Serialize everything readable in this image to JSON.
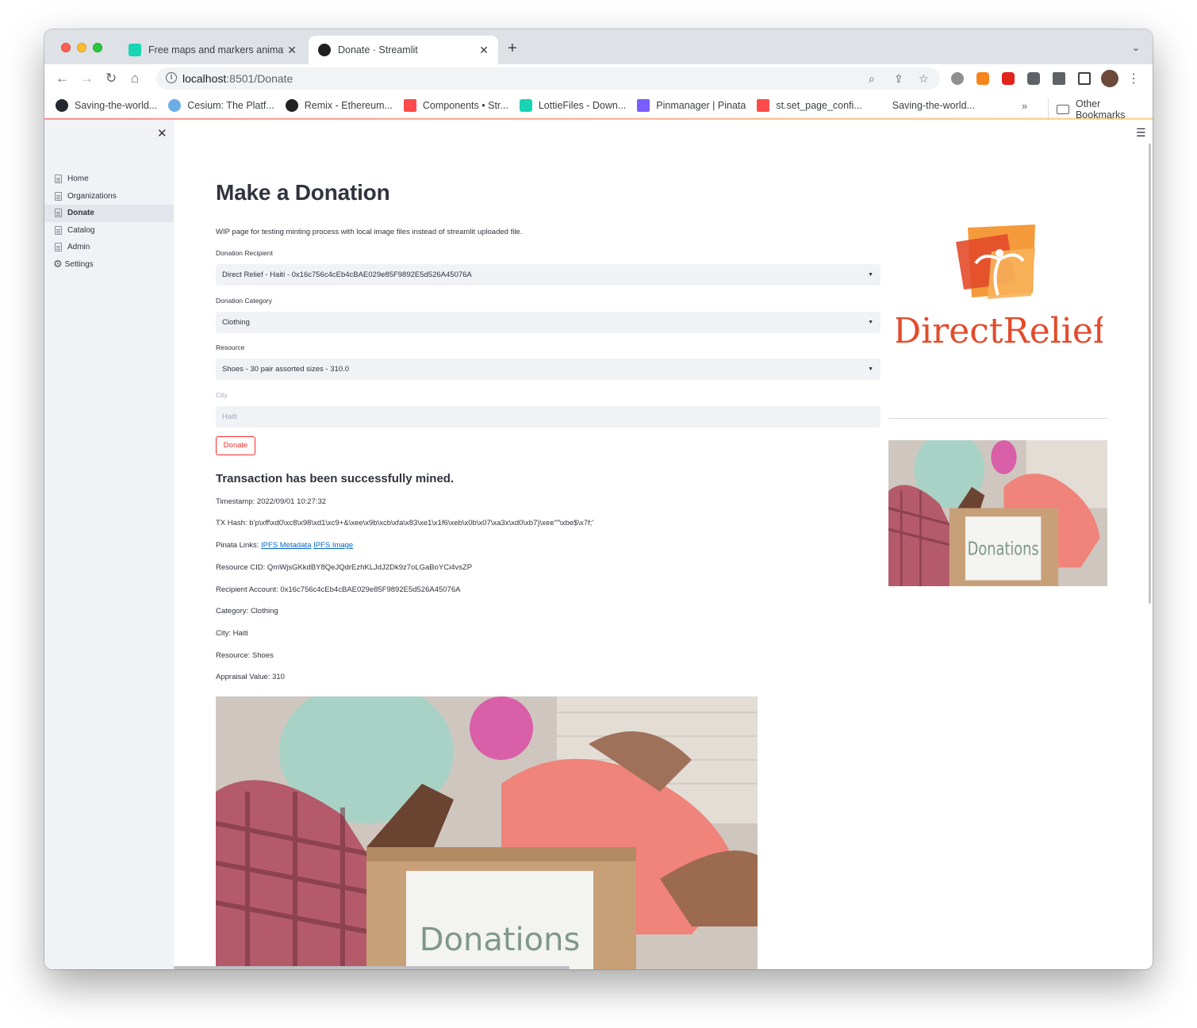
{
  "browser": {
    "tabs": [
      {
        "title": "Free maps and markers animat",
        "close": "✕",
        "active": false
      },
      {
        "title": "Donate · Streamlit",
        "close": "✕",
        "active": true
      }
    ],
    "new_tab": "+",
    "url_host": "localhost",
    "url_path": ":8501/Donate",
    "bookmarks": [
      {
        "label": "Saving-the-world...",
        "icon": "github-icon",
        "color": "#24292f"
      },
      {
        "label": "Cesium: The Platf...",
        "icon": "cesium-icon",
        "color": "#6cade5"
      },
      {
        "label": "Remix - Ethereum...",
        "icon": "remix-icon",
        "color": "#222222"
      },
      {
        "label": "Components • Str...",
        "icon": "streamlit-icon",
        "color": "#ff4b4b"
      },
      {
        "label": "LottieFiles - Down...",
        "icon": "lottie-icon",
        "color": "#17d4b4"
      },
      {
        "label": "Pinmanager | Pinata",
        "icon": "pinata-icon",
        "color": "#7a5cff"
      },
      {
        "label": "st.set_page_confi...",
        "icon": "streamlit-icon",
        "color": "#ff4b4b"
      },
      {
        "label": "Saving-the-world...",
        "icon": "blank-icon",
        "color": "#ffffff"
      }
    ],
    "more_bookmarks": "»",
    "other_bookmarks": "Other Bookmarks"
  },
  "sidebar": {
    "close": "✕",
    "items": [
      {
        "label": "Home",
        "icon": "page-icon",
        "active": false
      },
      {
        "label": "Organizations",
        "icon": "page-icon",
        "active": false
      },
      {
        "label": "Donate",
        "icon": "page-icon",
        "active": true
      },
      {
        "label": "Catalog",
        "icon": "page-icon",
        "active": false
      },
      {
        "label": "Admin",
        "icon": "page-icon",
        "active": false
      },
      {
        "label": "Settings",
        "icon": "gear-icon",
        "active": false
      }
    ]
  },
  "main": {
    "title": "Make a Donation",
    "description": "WIP page for testing minting process with local image files instead of streamlit uploaded file.",
    "recipient_label": "Donation Recipient",
    "recipient_value": "Direct Relief - Haiti - 0x16c756c4cEb4cBAE029e85F9892E5d526A45076A",
    "category_label": "Donation Category",
    "category_value": "Clothing",
    "resource_label": "Resource",
    "resource_value": "Shoes - 30 pair assorted sizes - 310.0",
    "city_label": "City",
    "city_value": "Haiti",
    "donate_button": "Donate",
    "success_heading": "Transaction has been successfully mined.",
    "timestamp": "Timestamp: 2022/09/01 10:27:32",
    "tx_hash": "TX Hash: b'p\\xff\\xd0\\xc8\\x98\\xd1\\xc9+&\\xee\\x9b\\xcb\\xfa\\x83\\xe1\\x1f6\\xeb\\x0b\\x07\\xa3x\\xd0\\xb7)\\xee\"\"\\xbe$\\x7f;'",
    "pinata_prefix": "Pinata Links: ",
    "ipfs_metadata": "IPFS Metadata",
    "ipfs_image": "IPFS Image",
    "resource_cid": "Resource CID: QmWjsGKkdBY8QeJQdrEzhKLJdJ2Dk9z7oLGaBoYCi4vsZP",
    "recipient_account": "Recipient Account: 0x16c756c4cEb4cBAE029e85F9892E5d526A45076A",
    "category": "Category: Clothing",
    "city": "City: Haiti",
    "resource": "Resource: Shoes",
    "appraisal": "Appraisal Value: 310"
  },
  "side_panel": {
    "logo_text": "DirectRelief",
    "box_label": "Donations"
  },
  "colors": {
    "accent": "#ff2b2b",
    "link": "#0068c9",
    "sidebar_bg": "#f0f2f6",
    "logo_red": "#e34b2b",
    "logo_orange": "#f59a3a"
  }
}
